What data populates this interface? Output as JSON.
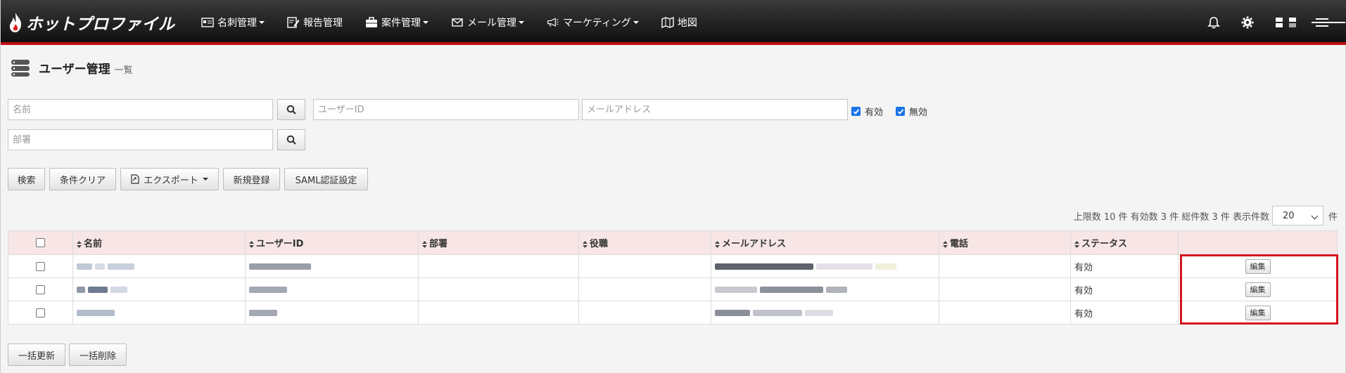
{
  "app": {
    "logo_text": "ホットプロファイル",
    "nav": [
      {
        "label": "名刺管理",
        "icon": "card-icon",
        "dropdown": true
      },
      {
        "label": "報告管理",
        "icon": "report-icon",
        "dropdown": false
      },
      {
        "label": "案件管理",
        "icon": "briefcase-icon",
        "dropdown": true
      },
      {
        "label": "メール管理",
        "icon": "mail-icon",
        "dropdown": true
      },
      {
        "label": "マーケティング",
        "icon": "megaphone-icon",
        "dropdown": true
      },
      {
        "label": "地図",
        "icon": "map-icon",
        "dropdown": false
      }
    ],
    "accent_color": "#c00e16"
  },
  "page": {
    "title": "ユーザー管理",
    "subtitle": "一覧"
  },
  "filters": {
    "name_placeholder": "名前",
    "userid_placeholder": "ユーザーID",
    "email_placeholder": "メールアドレス",
    "dept_placeholder": "部署",
    "active_label": "有効",
    "inactive_label": "無効",
    "active_checked": true,
    "inactive_checked": true
  },
  "actions": {
    "search": "検索",
    "clear": "条件クリア",
    "export": "エクスポート",
    "new": "新規登録",
    "saml": "SAML認証設定"
  },
  "summary": {
    "text": "上限数 10 件 有効数 3 件 総件数 3 件 表示件数",
    "page_size": "20",
    "unit": "件"
  },
  "table": {
    "headers": [
      "名前",
      "ユーザーID",
      "部署",
      "役職",
      "メールアドレス",
      "電話",
      "ステータス"
    ],
    "rows": [
      {
        "status": "有効",
        "edit": "編集"
      },
      {
        "status": "有効",
        "edit": "編集"
      },
      {
        "status": "有効",
        "edit": "編集"
      }
    ]
  },
  "bulk": {
    "update": "一括更新",
    "delete": "一括削除"
  }
}
